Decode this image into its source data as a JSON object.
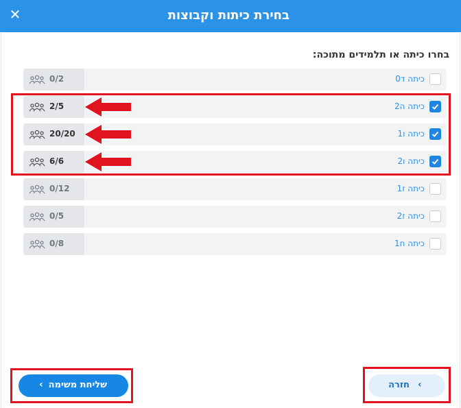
{
  "dialog": {
    "title": "בחירת כיתות וקבוצות",
    "close_symbol": "✕",
    "prompt": "בחרו כיתה או תלמידים מתוכה:"
  },
  "classes": [
    {
      "label": "כיתה ד0",
      "count": "0/2",
      "checked": false
    },
    {
      "label": "כיתה ה2",
      "count": "2/5",
      "checked": true
    },
    {
      "label": "כיתה ו1",
      "count": "20/20",
      "checked": true
    },
    {
      "label": "כיתה ו2",
      "count": "6/6",
      "checked": true
    },
    {
      "label": "כיתה ז1",
      "count": "0/12",
      "checked": false
    },
    {
      "label": "כיתה ז2",
      "count": "0/5",
      "checked": false
    },
    {
      "label": "כיתה ח1",
      "count": "0/8",
      "checked": false
    }
  ],
  "footer": {
    "send_label": "שליחת משימה",
    "send_chevron": "‹",
    "back_label": "חזרה",
    "back_chevron": "‹"
  },
  "colors": {
    "header": "#2a93e8",
    "primary_button": "#1787e6",
    "annotation": "#e0131f"
  },
  "icons": {
    "people": "group-people-icon",
    "close": "close-icon",
    "checkmark": "checkmark-icon",
    "chevron": "chevron-left-icon",
    "annotation_arrow": "red-arrow-icon"
  }
}
